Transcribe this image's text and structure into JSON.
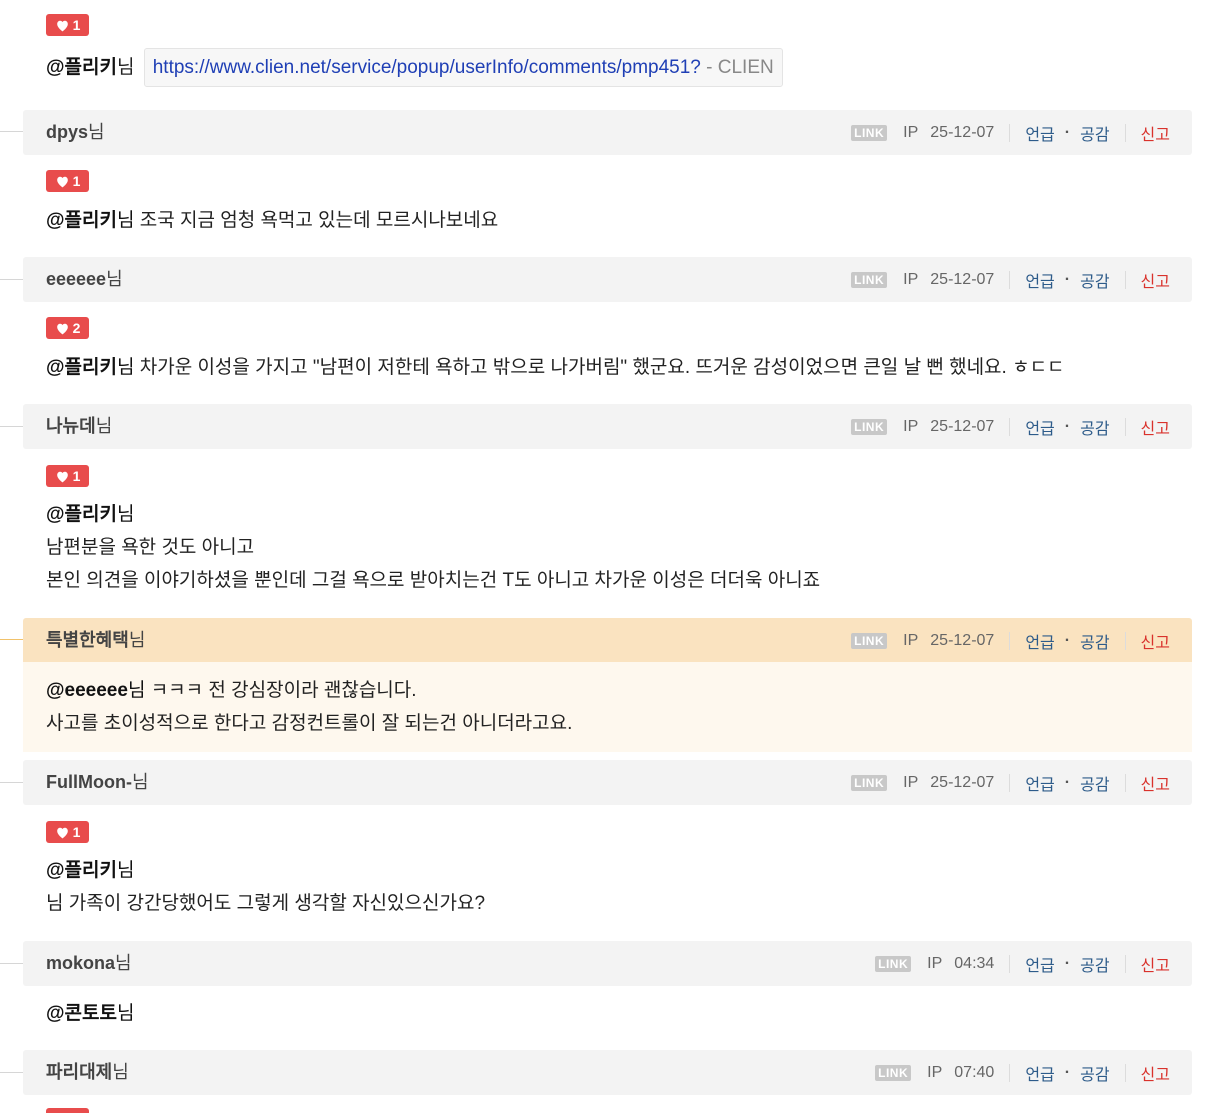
{
  "colors": {
    "like_red": "#e84c4c",
    "header_bg": "#f3f3f3",
    "highlight_header_bg": "#fae3c0",
    "highlight_body_bg": "#fef8ee",
    "action_blue": "#2d5b8a",
    "report_red": "#d9322c"
  },
  "labels": {
    "link": "LINK",
    "ip": "IP",
    "mention": "언급",
    "empathy": "공감",
    "report": "신고",
    "nim": "님",
    "dot": "·"
  },
  "top": {
    "likes": "1",
    "mention": "@플리키",
    "url": "https://www.clien.net/service/popup/userInfo/comments/pmp451?",
    "site_sep": "-",
    "site": "CLIEN"
  },
  "comments": [
    {
      "author": "dpys",
      "time": "25-12-07",
      "likes": "1",
      "mention": "@플리키",
      "lines": [
        "조국 지금 엄청 욕먹고 있는데 모르시나보네요"
      ]
    },
    {
      "author": "eeeeee",
      "time": "25-12-07",
      "likes": "2",
      "mention": "@플리키",
      "lines": [
        "차가운 이성을 가지고 \"남편이 저한테 욕하고 밖으로 나가버림\" 했군요. 뜨거운 감성이었으면 큰일 날 뻔 했네요. ㅎㄷㄷ"
      ]
    },
    {
      "author": "나뉴데",
      "time": "25-12-07",
      "likes": "1",
      "mention": "@플리키",
      "lines": [
        "남편분을 욕한 것도 아니고",
        "본인 의견을 이야기하셨을 뿐인데 그걸 욕으로 받아치는건 T도 아니고 차가운 이성은 더더욱 아니죠"
      ]
    },
    {
      "author": "특별한혜택",
      "time": "25-12-07",
      "mention": "@eeeeee",
      "lines": [
        "ㅋㅋㅋ 전 강심장이라 괜찮습니다.",
        "사고를 초이성적으로 한다고 감정컨트롤이 잘 되는건 아니더라고요."
      ]
    },
    {
      "author": "FullMoon-",
      "time": "25-12-07",
      "likes": "1",
      "mention": "@플리키",
      "lines": [
        "가족이 강간당했어도 그렇게 생각할 자신있으신가요?"
      ]
    },
    {
      "author": "mokona",
      "time": "04:34",
      "mention": "@콘토토",
      "lines": []
    },
    {
      "author": "파리대제",
      "time": "07:40"
    }
  ]
}
